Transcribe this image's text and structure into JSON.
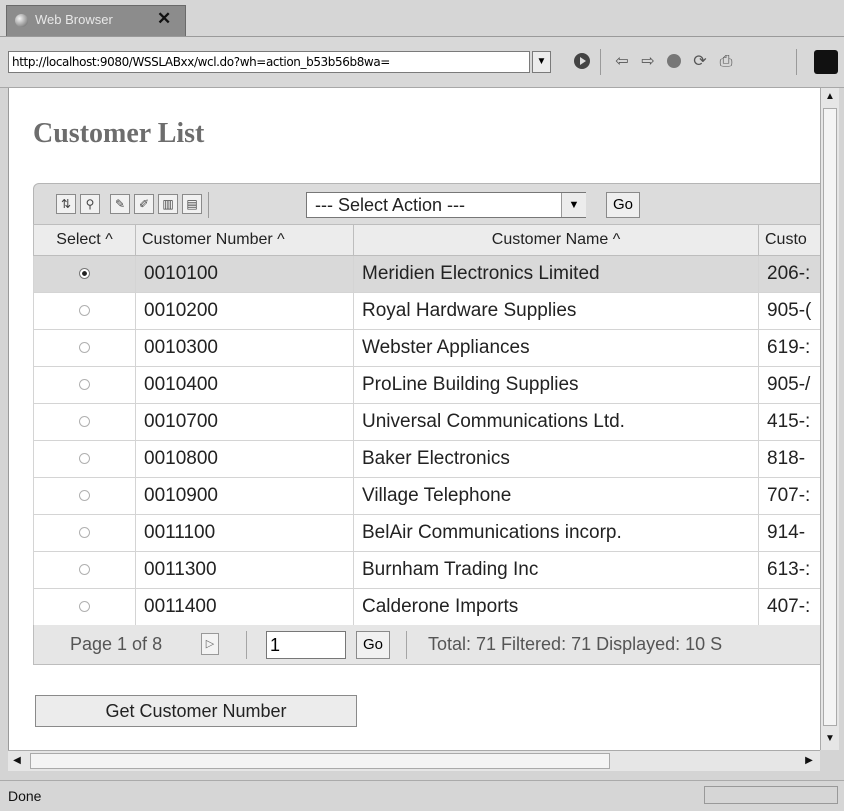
{
  "browser": {
    "tab_title": "Web Browser",
    "tab_close": "✕",
    "url": "http://localhost:9080/WSSLABxx/wcl.do?wh=action_b53b56b8wa=",
    "status": "Done"
  },
  "page": {
    "title": "Customer List",
    "select_action": "--- Select Action ---",
    "go_label": "Go",
    "columns": [
      "Select ^",
      "Customer Number ^",
      "Customer Name ^",
      "Custo"
    ],
    "rows": [
      {
        "number": "0010100",
        "name": "Meridien Electronics Limited",
        "phone": "206-:",
        "selected": true
      },
      {
        "number": "0010200",
        "name": "Royal Hardware Supplies",
        "phone": "905-(",
        "selected": false
      },
      {
        "number": "0010300",
        "name": "Webster Appliances",
        "phone": "619-:",
        "selected": false
      },
      {
        "number": "0010400",
        "name": "ProLine Building Supplies",
        "phone": "905-/",
        "selected": false
      },
      {
        "number": "0010700",
        "name": "Universal Communications Ltd.",
        "phone": "415-:",
        "selected": false
      },
      {
        "number": "0010800",
        "name": "Baker Electronics",
        "phone": "818-",
        "selected": false
      },
      {
        "number": "0010900",
        "name": "Village Telephone",
        "phone": "707-:",
        "selected": false
      },
      {
        "number": "0011100",
        "name": "BelAir Communications incorp.",
        "phone": "914-",
        "selected": false
      },
      {
        "number": "0011300",
        "name": "Burnham Trading Inc",
        "phone": "613-:",
        "selected": false
      },
      {
        "number": "0011400",
        "name": "Calderone Imports",
        "phone": "407-:",
        "selected": false
      }
    ],
    "pager": {
      "label": "Page 1 of 8",
      "page_input": "1",
      "go_label": "Go",
      "total": "Total: 71 Filtered: 71 Displayed: 10 S"
    },
    "get_button": "Get Customer Number"
  }
}
